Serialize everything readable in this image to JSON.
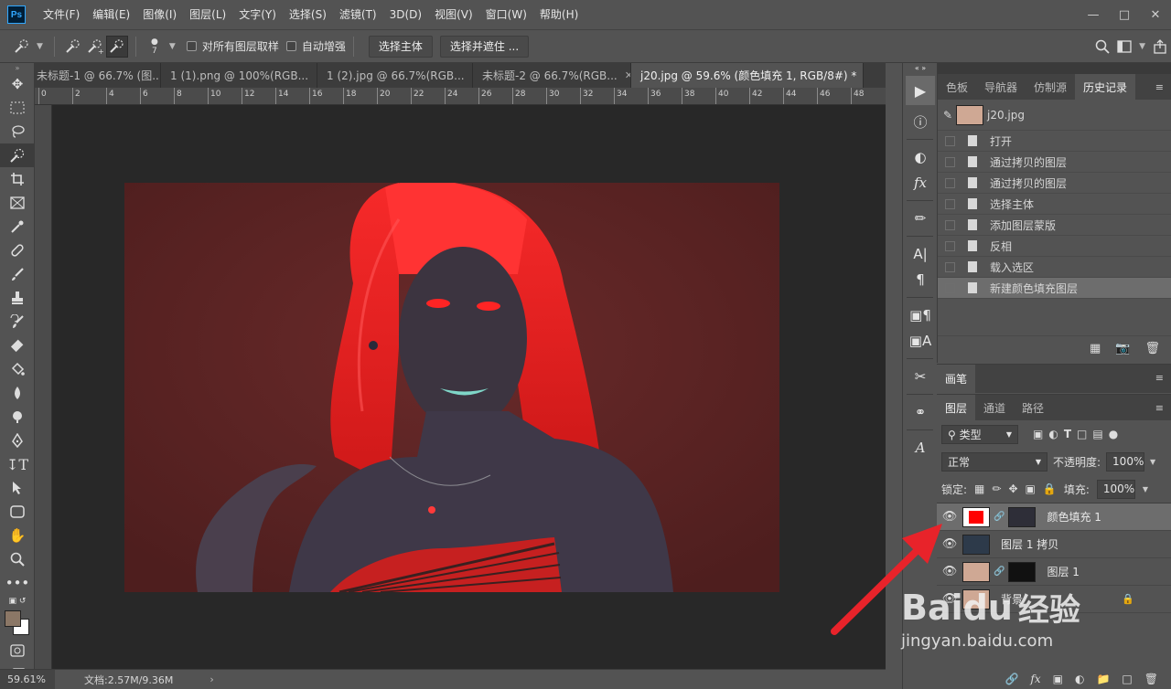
{
  "app": {
    "logo": "Ps",
    "menu": [
      "文件(F)",
      "编辑(E)",
      "图像(I)",
      "图层(L)",
      "文字(Y)",
      "选择(S)",
      "滤镜(T)",
      "3D(D)",
      "视图(V)",
      "窗口(W)",
      "帮助(H)"
    ]
  },
  "options": {
    "brush_size": "7",
    "sample_all_label": "对所有图层取样",
    "auto_enhance_label": "自动增强",
    "select_subject_label": "选择主体",
    "select_mask_label": "选择并遮住 ..."
  },
  "tabs": [
    {
      "label": "未标题-1 @ 66.7% (图...",
      "active": false
    },
    {
      "label": "1 (1).png @ 100%(RGB...",
      "active": false
    },
    {
      "label": "1 (2).jpg @ 66.7%(RGB...",
      "active": false
    },
    {
      "label": "未标题-2 @ 66.7%(RGB...",
      "active": false
    },
    {
      "label": "j20.jpg @ 59.6% (颜色填充 1, RGB/8#) *",
      "active": true
    }
  ],
  "ruler": {
    "labels": [
      "0",
      "2",
      "4",
      "6",
      "8",
      "10",
      "12",
      "14",
      "16",
      "18",
      "20",
      "22",
      "24",
      "26",
      "28",
      "30",
      "32",
      "34",
      "36",
      "38",
      "40",
      "42",
      "44",
      "46",
      "48"
    ]
  },
  "status": {
    "zoom": "59.61%",
    "doc_size": "文档:2.57M/9.36M"
  },
  "history_panel": {
    "tabs": [
      "色板",
      "导航器",
      "仿制源",
      "历史记录"
    ],
    "active_tab": "历史记录",
    "snapshot": "j20.jpg",
    "items": [
      "打开",
      "通过拷贝的图层",
      "通过拷贝的图层",
      "选择主体",
      "添加图层蒙版",
      "反相",
      "载入选区",
      "新建颜色填充图层"
    ],
    "selected_index": 7
  },
  "brush_panel": {
    "tab": "画笔"
  },
  "layers_panel": {
    "tabs": [
      "图层",
      "通道",
      "路径"
    ],
    "filter_label": "类型",
    "blend_mode": "正常",
    "opacity_label": "不透明度:",
    "opacity": "100%",
    "lock_label": "锁定:",
    "fill_label": "填充:",
    "fill": "100%",
    "layers": [
      {
        "name": "颜色填充 1",
        "selected": true
      },
      {
        "name": "图层 1 拷贝",
        "selected": false
      },
      {
        "name": "图层 1",
        "selected": false
      },
      {
        "name": "背景",
        "selected": false
      }
    ]
  },
  "watermark": {
    "brand": "Baidu",
    "cn": "经验",
    "url": "jingyan.baidu.com"
  },
  "colors": {
    "fill_layer": "#ff0000",
    "arrow": "#e8232a",
    "foreground": "#8b7766",
    "background": "#ffffff"
  }
}
